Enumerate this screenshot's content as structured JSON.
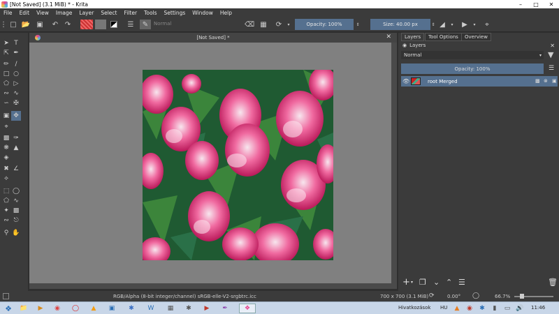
{
  "window": {
    "title": "[Not Saved]  (3.1 MiB)  * - Krita"
  },
  "menu": [
    "File",
    "Edit",
    "View",
    "Image",
    "Layer",
    "Select",
    "Filter",
    "Tools",
    "Settings",
    "Window",
    "Help"
  ],
  "toolbar": {
    "blend_mode": "Normal",
    "opacity": "Opacity: 100%",
    "size": "Size: 40.00 px"
  },
  "document": {
    "tab_title": "[Not Saved]  *"
  },
  "docker": {
    "tabs": [
      "Layers",
      "Tool Options",
      "Overview"
    ],
    "section_title": "Layers",
    "blend_mode": "Normal",
    "opacity": "Opacity: 100%",
    "layers": [
      {
        "name": "root Merged"
      }
    ]
  },
  "status": {
    "color_profile": "RGB/Alpha (8-bit integer/channel)  sRGB-elle-V2-srgbtrc.icc",
    "dimensions": "700 x 700 (3.1 MiB)",
    "rotation": "0.00°",
    "zoom": "66.7%"
  },
  "taskbar": {
    "notification": "Hivatkozások",
    "language": "HU",
    "time": "11:46"
  },
  "colors": {
    "accent": "#55708f",
    "canvas": "#808080",
    "panel": "#3b3b3b"
  }
}
